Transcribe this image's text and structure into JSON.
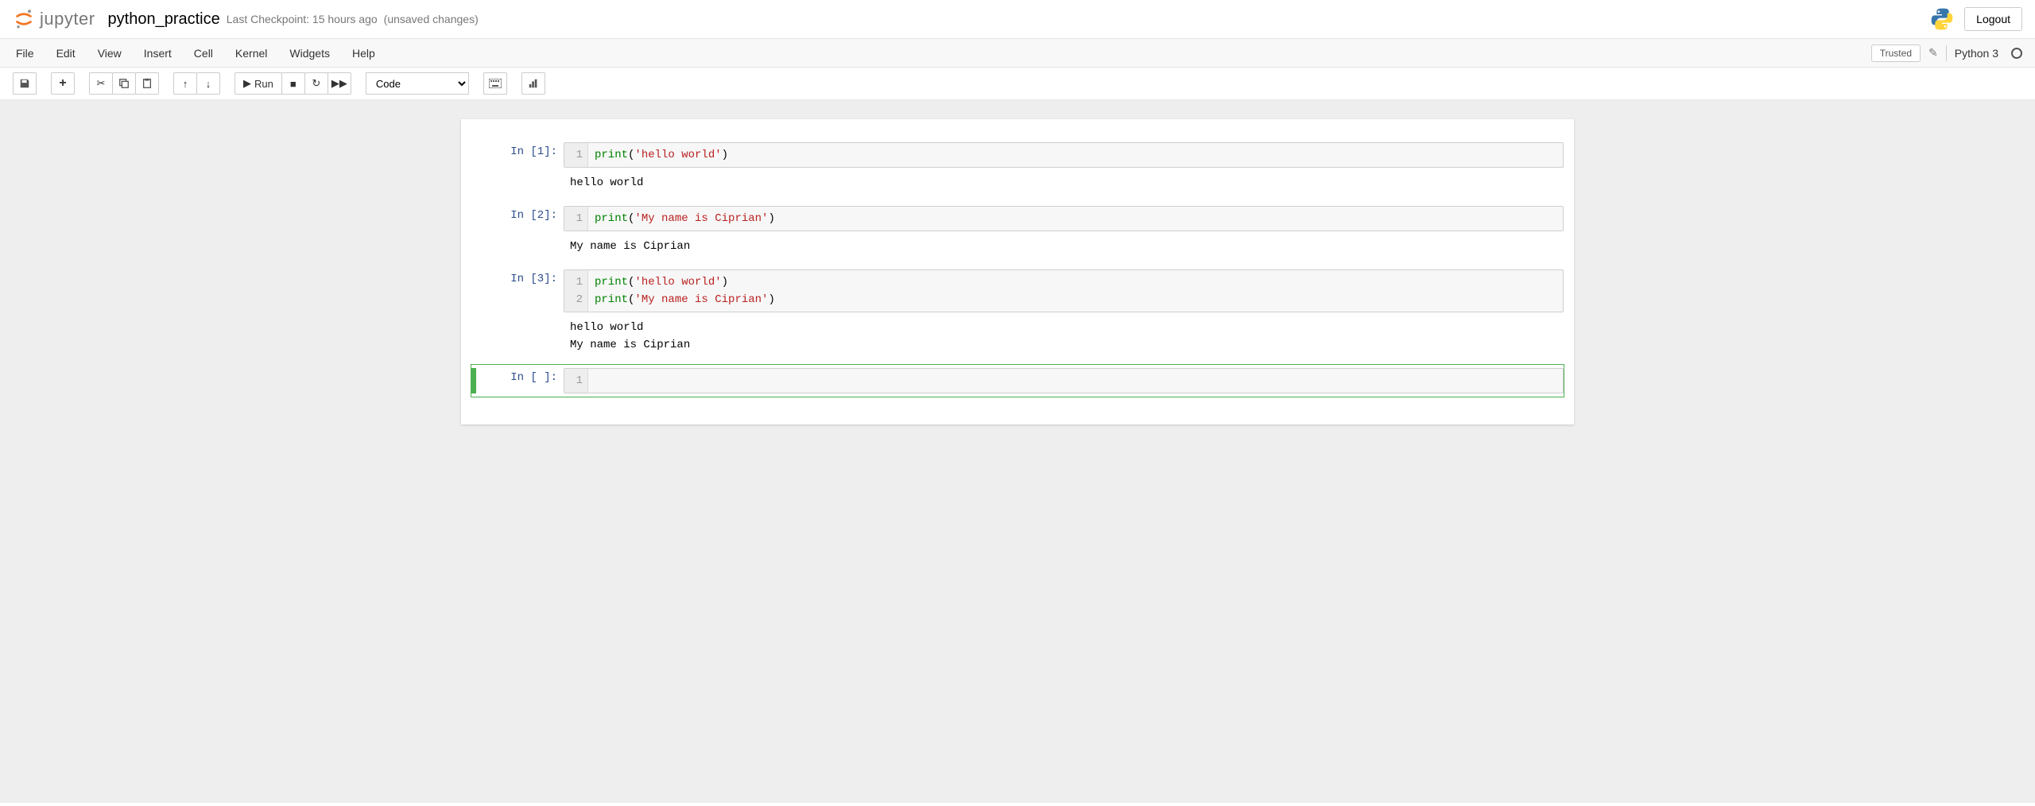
{
  "header": {
    "logo_text": "jupyter",
    "notebook_name": "python_practice",
    "checkpoint": "Last Checkpoint: 15 hours ago",
    "unsaved": "(unsaved changes)",
    "logout": "Logout"
  },
  "menubar": {
    "items": [
      "File",
      "Edit",
      "View",
      "Insert",
      "Cell",
      "Kernel",
      "Widgets",
      "Help"
    ],
    "trusted": "Trusted",
    "kernel": "Python 3"
  },
  "toolbar": {
    "run_label": "Run",
    "cell_type": "Code"
  },
  "cells": [
    {
      "prompt": "In [1]:",
      "lines": [
        {
          "n": "1",
          "tokens": [
            {
              "t": "print",
              "c": "builtin"
            },
            {
              "t": "(",
              "c": "punct"
            },
            {
              "t": "'hello world'",
              "c": "string"
            },
            {
              "t": ")",
              "c": "punct"
            }
          ]
        }
      ],
      "output": "hello world",
      "selected": false
    },
    {
      "prompt": "In [2]:",
      "lines": [
        {
          "n": "1",
          "tokens": [
            {
              "t": "print",
              "c": "builtin"
            },
            {
              "t": "(",
              "c": "punct"
            },
            {
              "t": "'My name is Ciprian'",
              "c": "string"
            },
            {
              "t": ")",
              "c": "punct"
            }
          ]
        }
      ],
      "output": "My name is Ciprian",
      "selected": false
    },
    {
      "prompt": "In [3]:",
      "lines": [
        {
          "n": "1",
          "tokens": [
            {
              "t": "print",
              "c": "builtin"
            },
            {
              "t": "(",
              "c": "punct"
            },
            {
              "t": "'hello world'",
              "c": "string"
            },
            {
              "t": ")",
              "c": "punct"
            }
          ]
        },
        {
          "n": "2",
          "tokens": [
            {
              "t": "print",
              "c": "builtin"
            },
            {
              "t": "(",
              "c": "punct"
            },
            {
              "t": "'My name is Ciprian'",
              "c": "string"
            },
            {
              "t": ")",
              "c": "punct"
            }
          ]
        }
      ],
      "output": "hello world\nMy name is Ciprian",
      "selected": false
    },
    {
      "prompt": "In [ ]:",
      "lines": [
        {
          "n": "1",
          "tokens": []
        }
      ],
      "output": null,
      "selected": true
    }
  ]
}
